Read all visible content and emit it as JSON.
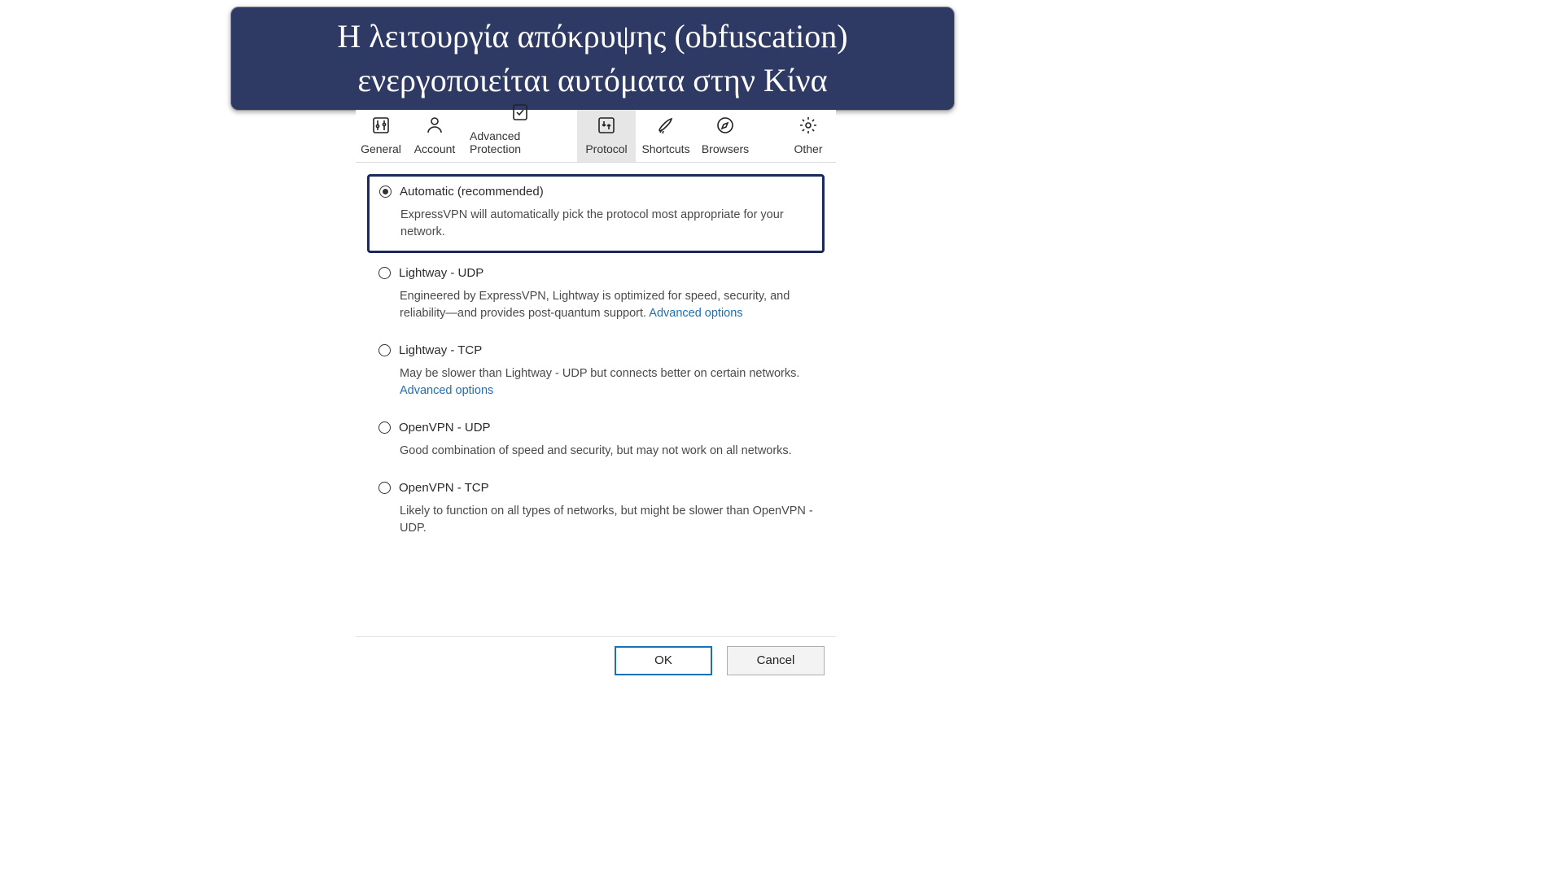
{
  "banner": {
    "line1": "Η λειτουργία απόκρυψης (obfuscation)",
    "line2": "ενεργοποιείται αυτόματα στην Κίνα"
  },
  "tabs": {
    "general": "General",
    "account": "Account",
    "advanced_protection": "Advanced Protection",
    "protocol": "Protocol",
    "shortcuts": "Shortcuts",
    "browsers": "Browsers",
    "other": "Other"
  },
  "protocols": {
    "automatic": {
      "title": "Automatic (recommended)",
      "desc": "ExpressVPN will automatically pick the protocol most appropriate for your network."
    },
    "lightway_udp": {
      "title": "Lightway - UDP",
      "desc": "Engineered by ExpressVPN, Lightway is optimized for speed, security, and reliability—and provides post-quantum support. ",
      "link": "Advanced options"
    },
    "lightway_tcp": {
      "title": "Lightway - TCP",
      "desc": "May be slower than Lightway - UDP but connects better on certain networks.",
      "link": "Advanced options"
    },
    "openvpn_udp": {
      "title": "OpenVPN - UDP",
      "desc": "Good combination of speed and security, but may not work on all networks."
    },
    "openvpn_tcp": {
      "title": "OpenVPN - TCP",
      "desc": "Likely to function on all types of networks, but might be slower than OpenVPN - UDP."
    }
  },
  "buttons": {
    "ok": "OK",
    "cancel": "Cancel"
  }
}
